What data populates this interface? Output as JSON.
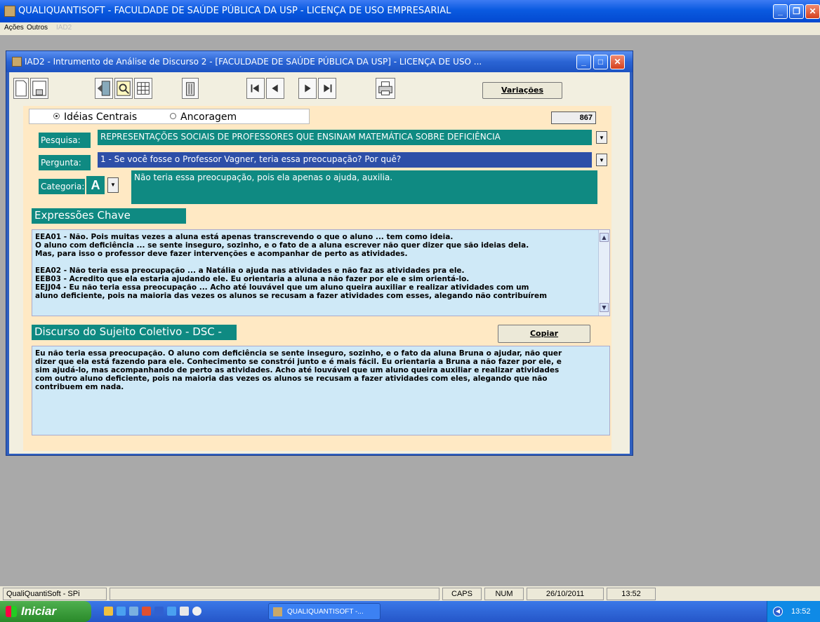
{
  "app": {
    "title": "QUALIQUANTISOFT - FACULDADE DE SAÚDE PÚBLICA DA USP - LICENÇA DE USO EMPRESARIAL",
    "menu": [
      "Ações",
      "Outros",
      "IAD2"
    ]
  },
  "child": {
    "title": "IAD2 - Intrumento de Análise de Discurso 2  - [FACULDADE DE SAÚDE PÚBLICA DA USP] - LICENÇA DE USO ..."
  },
  "toolbar": {
    "variacoes_label": "Variações"
  },
  "form": {
    "radio_options": [
      "Idéias Centrais",
      "Ancoragem"
    ],
    "radio_selected": "Idéias Centrais",
    "counter": "867",
    "pesquisa_label": "Pesquisa:",
    "pesquisa_value": "REPRESENTAÇÕES SOCIAIS DE PROFESSORES QUE ENSINAM MATEMÁTICA SOBRE DEFICIÊNCIA",
    "pergunta_label": "Pergunta:",
    "pergunta_value": "1 - Se você fosse o Professor Vagner, teria essa preocupação? Por quê?",
    "categoria_label": "Categoria:",
    "categoria_value": "A",
    "ideia_central": "Não teria essa preocupação, pois ela apenas o ajuda, auxilia."
  },
  "expressoes": {
    "header": "Expressões Chave",
    "lines": [
      "EEA01 -  Não. Pois muitas vezes a aluna está apenas transcrevendo o que o aluno ... tem como ideia.",
      "O aluno com deficiência ... se sente inseguro, sozinho, e o fato de a aluna escrever não quer dizer que são ideias dela.",
      "Mas, para isso o professor deve fazer intervenções e acompanhar de perto as atividades.",
      "",
      "EEA02 -  Não teria essa preocupação ... a Natália o ajuda nas atividades e não faz as atividades pra ele.",
      "EEB03 -  Acredito que ela estaria ajudando ele. Eu orientaria a aluna a não fazer por ele e sim orientá-lo.",
      "EEJJ04 -  Eu não teria essa preocupação ... Acho até louvável que um aluno queira auxiliar e realizar atividades com um",
      "aluno deficiente, pois na maioria das vezes os alunos se recusam a fazer atividades com esses, alegando não contribuírem"
    ]
  },
  "dsc": {
    "header": "Discurso do Sujeito Coletivo - DSC -",
    "copy_label": "Copiar",
    "lines": [
      "Eu não teria essa preocupação. O aluno com deficiência se sente inseguro, sozinho, e o fato da aluna Bruna o ajudar, não quer",
      "dizer que ela está fazendo para ele. Conhecimento se constrói junto e é mais fácil. Eu orientaria a Bruna a não fazer por ele, e",
      "sim ajudá-lo, mas acompanhando de perto as atividades.  Acho até louvável que um aluno queira auxiliar e realizar atividades",
      "com outro aluno deficiente, pois na maioria das vezes os alunos se recusam a fazer atividades com eles, alegando que não",
      "contribuem em nada."
    ]
  },
  "statusbar": {
    "app": "QualiQuantiSoft - SPi",
    "caps": "CAPS",
    "num": "NUM",
    "date": "26/10/2011",
    "time": "13:52"
  },
  "taskbar": {
    "start": "Iniciar",
    "task": "QUALIQUANTISOFT -...",
    "clock": "13:52"
  }
}
